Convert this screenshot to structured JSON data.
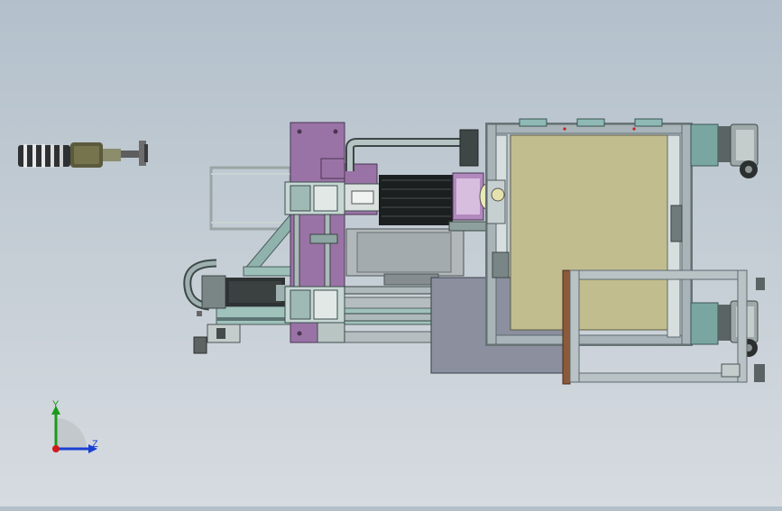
{
  "viewport": {
    "background_top": "#b3c0cb",
    "background_bottom": "#d6dbe0"
  },
  "triad": {
    "y_label": "Y",
    "z_label": "Z",
    "y_color": "#1a9a1a",
    "z_color": "#1a3fd0",
    "x_color": "#d21a1a"
  },
  "colors": {
    "frame": "#a9b4b8",
    "frame_dark": "#5d6a70",
    "purple": "#9a73a6",
    "panel_tan": "#c2bd8f",
    "teal": "#7aa6a2",
    "motor": "#2f3a3a",
    "block": "#8b8f9e"
  }
}
